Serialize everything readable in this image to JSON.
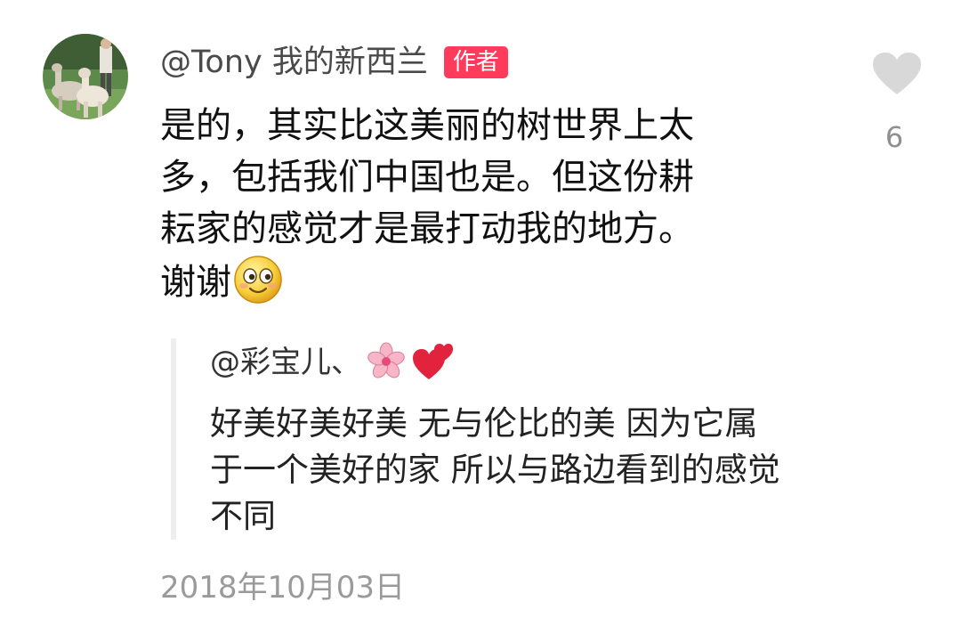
{
  "comment": {
    "avatar_icon": "alpaca-photo-avatar",
    "username": "@Tony 我的新西兰",
    "badge": "作者",
    "body_lines": [
      "是的，其实比这美丽的树世界上太",
      "多，包括我们中国也是。但这份耕",
      "耘家的感觉才是最打动我的地方。",
      "谢谢"
    ],
    "body_emoji": "smiley-face-icon",
    "likes": {
      "icon": "heart-icon",
      "count": "6",
      "color": "#d8d8d8"
    },
    "timestamp": "2018年10月03日"
  },
  "quoted": {
    "username": "@彩宝儿、",
    "username_emojis": [
      "cherry-blossom-icon",
      "two-hearts-icon"
    ],
    "text_lines": [
      "好美好美好美 无与伦比的美 因为它属",
      "于一个美好的家 所以与路边看到的感觉",
      "不同"
    ]
  },
  "colors": {
    "badge": "#ff3b5c",
    "quote_bar": "#eeeeee",
    "muted": "#9a9a9a"
  }
}
